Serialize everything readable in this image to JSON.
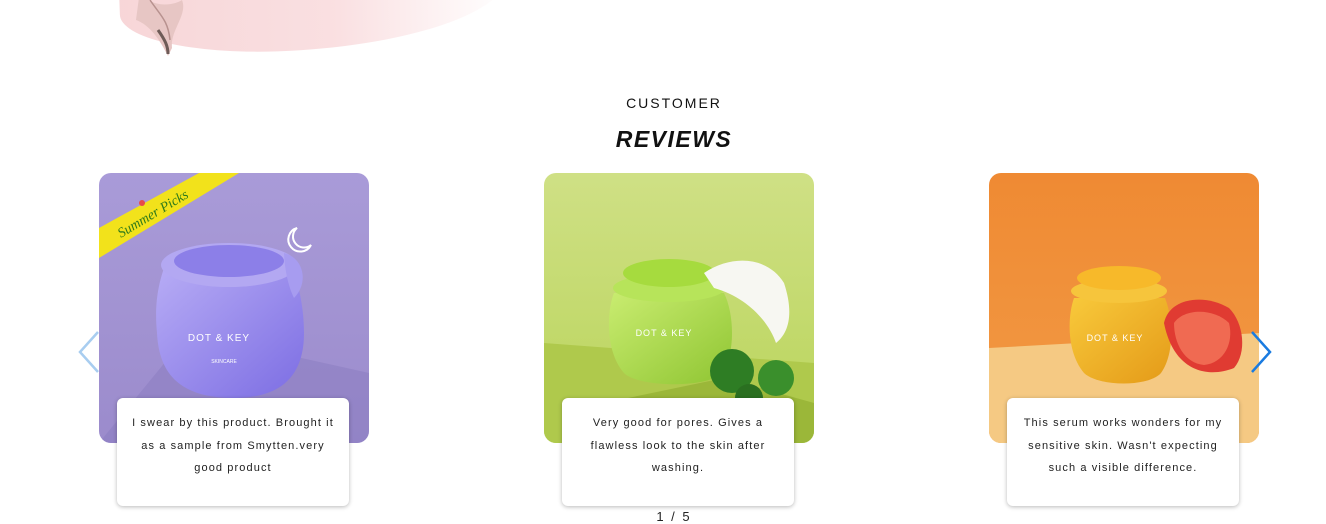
{
  "section": {
    "eyebrow": "CUSTOMER",
    "title": "REVIEWS"
  },
  "reviews": [
    {
      "product_label": "DOT & KEY",
      "badge": "Summer Picks",
      "text": "I swear by this product. Brought it as a sample from Smytten.very good product"
    },
    {
      "product_label": "DOT & KEY",
      "text": "Very good for pores. Gives a flawless look to the skin after washing."
    },
    {
      "product_label": "DOT & KEY",
      "text": "This serum works wonders for my sensitive skin. Wasn't expecting such a visible difference."
    }
  ],
  "pagination": {
    "text": "1 / 5"
  },
  "icons": {
    "prev": "chevron-left-icon",
    "next": "chevron-right-icon"
  },
  "colors": {
    "arrow_prev": "#a8cdf0",
    "arrow_next": "#1a7be0",
    "card1_bg": "#a899d6",
    "card2_bg": "#c6de77",
    "card3_bg": "#f08a36"
  }
}
